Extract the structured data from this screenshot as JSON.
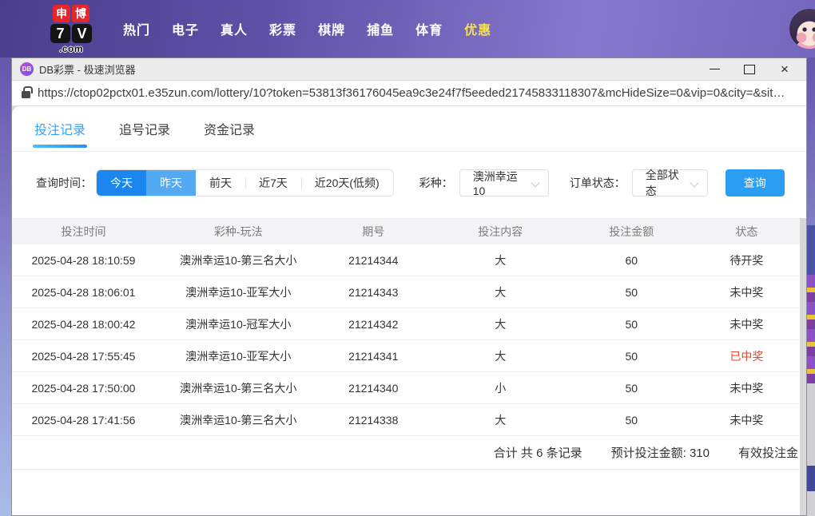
{
  "nav": {
    "logo": {
      "sq1": "申",
      "sq2": "博",
      "seven": "7",
      "vee": "V",
      "dotcom": ".com"
    },
    "items": [
      {
        "label": "热门",
        "highlight": false
      },
      {
        "label": "电子",
        "highlight": false
      },
      {
        "label": "真人",
        "highlight": false
      },
      {
        "label": "彩票",
        "highlight": false
      },
      {
        "label": "棋牌",
        "highlight": false
      },
      {
        "label": "捕鱼",
        "highlight": false
      },
      {
        "label": "体育",
        "highlight": false
      },
      {
        "label": "优惠",
        "highlight": true
      }
    ]
  },
  "window": {
    "favicon_text": "DB",
    "title": "DB彩票 - 极速浏览器",
    "url": "https://ctop02pctx01.e35zun.com/lottery/10?token=53813f36176045ea9c3e24f7f5eeded21745833118307&mcHideSize=0&vip=0&city=&sit…"
  },
  "tabs": [
    {
      "label": "投注记录",
      "active": true
    },
    {
      "label": "追号记录",
      "active": false
    },
    {
      "label": "资金记录",
      "active": false
    }
  ],
  "filters": {
    "time_label": "查询时间：",
    "time_options": [
      {
        "label": "今天",
        "state": "sel-dark"
      },
      {
        "label": "昨天",
        "state": "sel-light"
      },
      {
        "label": "前天",
        "state": "normal"
      },
      {
        "label": "近7天",
        "state": "normal"
      },
      {
        "label": "近20天(低频)",
        "state": "normal"
      }
    ],
    "lottery_label": "彩种：",
    "lottery_value": "澳洲幸运10",
    "status_label": "订单状态：",
    "status_value": "全部状态",
    "search_button": "查询"
  },
  "table": {
    "headers": [
      "投注时间",
      "彩种-玩法",
      "期号",
      "投注内容",
      "投注金额",
      "状态"
    ],
    "rows": [
      {
        "time": "2025-04-28 18:10:59",
        "game": "澳洲幸运10-第三名大小",
        "issue": "21214344",
        "content": "大",
        "amount": "60",
        "status": "待开奖",
        "status_type": "pending"
      },
      {
        "time": "2025-04-28 18:06:01",
        "game": "澳洲幸运10-亚军大小",
        "issue": "21214343",
        "content": "大",
        "amount": "50",
        "status": "未中奖",
        "status_type": "lose"
      },
      {
        "time": "2025-04-28 18:00:42",
        "game": "澳洲幸运10-冠军大小",
        "issue": "21214342",
        "content": "大",
        "amount": "50",
        "status": "未中奖",
        "status_type": "lose"
      },
      {
        "time": "2025-04-28 17:55:45",
        "game": "澳洲幸运10-亚军大小",
        "issue": "21214341",
        "content": "大",
        "amount": "50",
        "status": "已中奖",
        "status_type": "win"
      },
      {
        "time": "2025-04-28 17:50:00",
        "game": "澳洲幸运10-第三名大小",
        "issue": "21214340",
        "content": "小",
        "amount": "50",
        "status": "未中奖",
        "status_type": "lose"
      },
      {
        "time": "2025-04-28 17:41:56",
        "game": "澳洲幸运10-第三名大小",
        "issue": "21214338",
        "content": "大",
        "amount": "50",
        "status": "未中奖",
        "status_type": "lose"
      }
    ]
  },
  "summary": {
    "total": "合计 共 6 条记录",
    "expected": "预计投注金额: 310",
    "valid": "有效投注金"
  },
  "colors": {
    "accent_blue": "#2b9df3",
    "time_selected_dark": "#1b87ee",
    "time_selected_light": "#54aaf2",
    "tab_active": "#3da0f0",
    "win_red": "#e5432f",
    "nav_highlight": "#f5e14b"
  }
}
